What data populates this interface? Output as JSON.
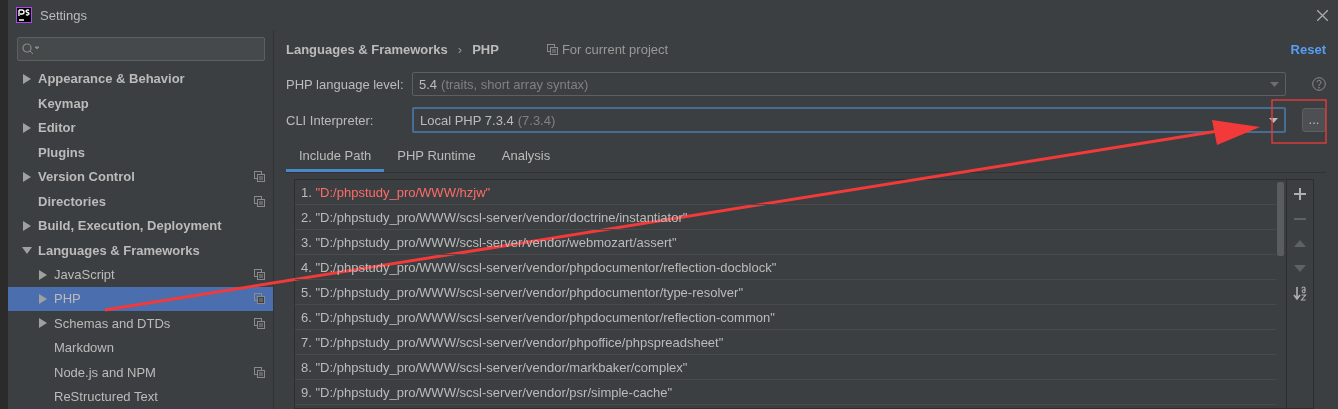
{
  "window": {
    "title": "Settings"
  },
  "sidebar": {
    "items": [
      {
        "label": "Appearance & Behavior",
        "expanded": false,
        "project_scope": false,
        "selected": false
      },
      {
        "label": "Keymap",
        "project_scope": false,
        "selected": false
      },
      {
        "label": "Editor",
        "expanded": false,
        "project_scope": false,
        "selected": false
      },
      {
        "label": "Plugins",
        "project_scope": false,
        "selected": false
      },
      {
        "label": "Version Control",
        "expanded": false,
        "project_scope": true,
        "selected": false
      },
      {
        "label": "Directories",
        "project_scope": true,
        "selected": false
      },
      {
        "label": "Build, Execution, Deployment",
        "expanded": false,
        "project_scope": false,
        "selected": false
      },
      {
        "label": "Languages & Frameworks",
        "expanded": true,
        "project_scope": false,
        "selected": false,
        "children": [
          {
            "label": "JavaScript",
            "expanded": false,
            "project_scope": true,
            "selected": false
          },
          {
            "label": "PHP",
            "expanded": false,
            "project_scope": true,
            "selected": true
          },
          {
            "label": "Schemas and DTDs",
            "expanded": false,
            "project_scope": true,
            "selected": false
          },
          {
            "label": "Markdown",
            "project_scope": false,
            "selected": false
          },
          {
            "label": "Node.js and NPM",
            "project_scope": true,
            "selected": false
          },
          {
            "label": "ReStructured Text",
            "project_scope": false,
            "selected": false
          }
        ]
      }
    ]
  },
  "header": {
    "breadcrumb": [
      "Languages & Frameworks",
      "PHP"
    ],
    "separator": "›",
    "scope": "For current project",
    "reset": "Reset"
  },
  "fields": [
    {
      "label": "PHP language level:",
      "value": "5.4",
      "hint": "(traits, short array syntax)",
      "focused": false,
      "help": true
    },
    {
      "label": "CLI Interpreter:",
      "value": "Local PHP 7.3.4",
      "hint": "(7.3.4)",
      "focused": true,
      "help": false,
      "browse": "..."
    }
  ],
  "tabs": [
    {
      "label": "Include Path",
      "selected": true
    },
    {
      "label": "PHP Runtime",
      "selected": false
    },
    {
      "label": "Analysis",
      "selected": false
    }
  ],
  "include_paths": [
    {
      "index": "1.",
      "path": "\"D:/phpstudy_pro/WWW/hzjw\"",
      "invalid": true
    },
    {
      "index": "2.",
      "path": "\"D:/phpstudy_pro/WWW/scsl-server/vendor/doctrine/instantiator\"",
      "invalid": false
    },
    {
      "index": "3.",
      "path": "\"D:/phpstudy_pro/WWW/scsl-server/vendor/webmozart/assert\"",
      "invalid": false
    },
    {
      "index": "4.",
      "path": "\"D:/phpstudy_pro/WWW/scsl-server/vendor/phpdocumentor/reflection-docblock\"",
      "invalid": false
    },
    {
      "index": "5.",
      "path": "\"D:/phpstudy_pro/WWW/scsl-server/vendor/phpdocumentor/type-resolver\"",
      "invalid": false
    },
    {
      "index": "6.",
      "path": "\"D:/phpstudy_pro/WWW/scsl-server/vendor/phpdocumentor/reflection-common\"",
      "invalid": false
    },
    {
      "index": "7.",
      "path": "\"D:/phpstudy_pro/WWW/scsl-server/vendor/phpoffice/phpspreadsheet\"",
      "invalid": false
    },
    {
      "index": "8.",
      "path": "\"D:/phpstudy_pro/WWW/scsl-server/vendor/markbaker/complex\"",
      "invalid": false
    },
    {
      "index": "9.",
      "path": "\"D:/phpstudy_pro/WWW/scsl-server/vendor/psr/simple-cache\"",
      "invalid": false
    }
  ],
  "list_toolbar": [
    {
      "kind": "add",
      "disabled": false
    },
    {
      "kind": "remove",
      "disabled": true
    },
    {
      "kind": "up",
      "disabled": true
    },
    {
      "kind": "down",
      "disabled": true
    },
    {
      "kind": "sort",
      "disabled": false
    }
  ]
}
